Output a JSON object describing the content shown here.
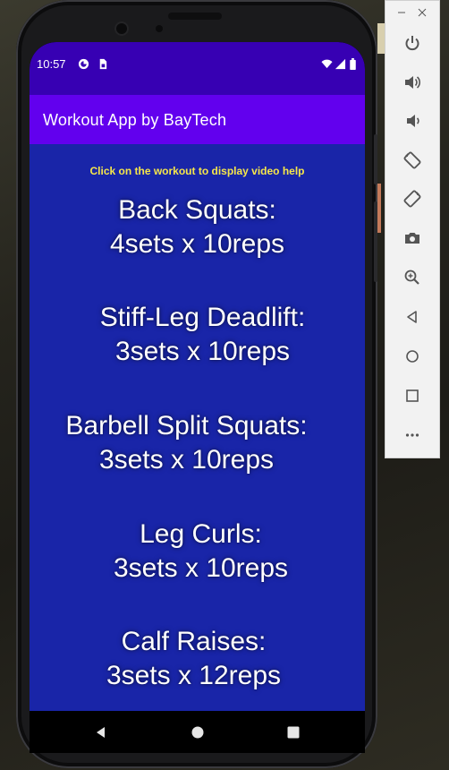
{
  "status_bar": {
    "time": "10:57",
    "icons": [
      "google-icon",
      "sim-card-icon",
      "wifi-icon",
      "signal-icon",
      "battery-icon"
    ]
  },
  "app_bar": {
    "title": "Workout App by BayTech"
  },
  "content": {
    "hint": "Click on the workout to display video help",
    "workouts": [
      {
        "name": "Back Squats:",
        "detail": "4sets x 10reps"
      },
      {
        "name": "Stiff-Leg Deadlift:",
        "detail": "3sets x 10reps"
      },
      {
        "name": "Barbell Split Squats:",
        "detail": "3sets x 10reps"
      },
      {
        "name": "Leg Curls:",
        "detail": "3sets x 10reps"
      },
      {
        "name": "Calf Raises:",
        "detail": "3sets x 12reps"
      }
    ]
  },
  "nav_bar": {
    "buttons": [
      "back-icon",
      "home-icon",
      "recents-icon"
    ]
  },
  "emulator_panel": {
    "window_controls": [
      "minimize-icon",
      "close-icon"
    ],
    "tools": [
      "power-icon",
      "volume-up-icon",
      "volume-down-icon",
      "rotate-left-icon",
      "rotate-right-icon",
      "screenshot-icon",
      "zoom-icon",
      "back-icon",
      "home-icon",
      "overview-icon",
      "more-icon"
    ]
  },
  "colors": {
    "status_bar": "#3700b3",
    "app_bar": "#6200ee",
    "content_bg": "#1925a8",
    "hint_text": "#f6e64a",
    "workout_text": "#ffffff"
  }
}
